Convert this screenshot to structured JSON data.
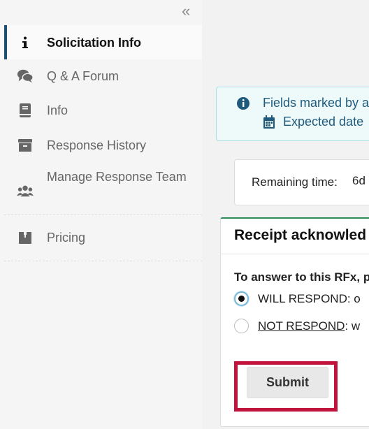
{
  "sidebar": {
    "collapse_glyph": "«",
    "items": [
      {
        "label": "Solicitation Info",
        "icon": "info-icon",
        "active": true
      },
      {
        "label": "Q & A Forum",
        "icon": "comments-icon"
      },
      {
        "label": "Info",
        "icon": "book-icon"
      },
      {
        "label": "Response History",
        "icon": "archive-icon"
      },
      {
        "label": "Manage Response Team",
        "icon": "users-icon"
      },
      {
        "label": "Pricing",
        "icon": "box-icon"
      }
    ]
  },
  "info_box": {
    "line1": "Fields marked by a",
    "line2": "Expected date"
  },
  "remaining": {
    "label": "Remaining time:",
    "value": "6d"
  },
  "receipt": {
    "title": "Receipt acknowled",
    "prompt": "To answer to this RFx, p",
    "options": [
      {
        "label_strong": "WILL RESPOND",
        "label_rest": ": o",
        "checked": true
      },
      {
        "label_strong": "NOT RESPOND",
        "label_rest": ": w",
        "checked": false
      }
    ],
    "submit_label": "Submit"
  },
  "colors": {
    "accent": "#1d4f73",
    "highlight": "#c0143c",
    "info_text": "#1f5a7c",
    "card_border_top": "#2e8b57"
  }
}
